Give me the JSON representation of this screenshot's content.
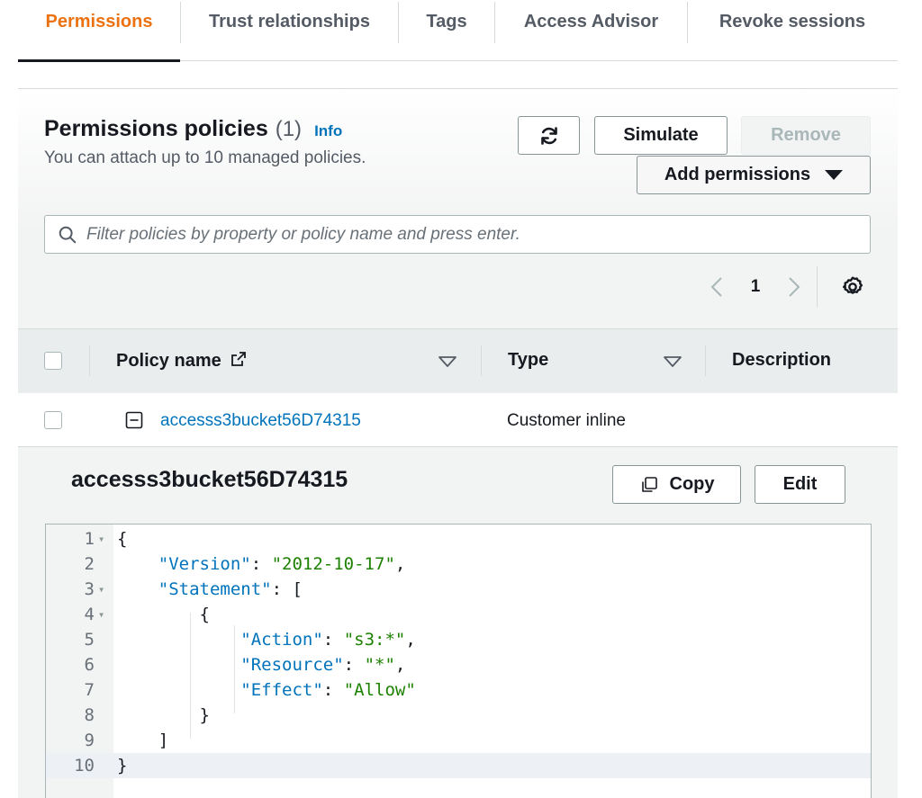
{
  "tabs": [
    {
      "label": "Permissions",
      "active": true
    },
    {
      "label": "Trust relationships",
      "active": false
    },
    {
      "label": "Tags",
      "active": false
    },
    {
      "label": "Access Advisor",
      "active": false
    },
    {
      "label": "Revoke sessions",
      "active": false
    }
  ],
  "panel": {
    "title": "Permissions policies",
    "count": "(1)",
    "info_link": "Info",
    "subtitle": "You can attach up to 10 managed policies."
  },
  "actions": {
    "refresh_icon": "refresh-icon",
    "simulate_label": "Simulate",
    "remove_label": "Remove",
    "add_permissions_label": "Add permissions"
  },
  "search": {
    "placeholder": "Filter policies by property or policy name and press enter.",
    "value": ""
  },
  "pagination": {
    "current_page": "1",
    "settings_icon": "gear-icon"
  },
  "table": {
    "columns": [
      "Policy name",
      "Type",
      "Description"
    ],
    "rows": [
      {
        "policy_name": "accesss3bucket56D74315",
        "type": "Customer inline",
        "description": ""
      }
    ]
  },
  "detail": {
    "title": "accesss3bucket56D74315",
    "copy_label": "Copy",
    "edit_label": "Edit"
  },
  "policy_json_lines": [
    "{",
    "    \"Version\": \"2012-10-17\",",
    "    \"Statement\": [",
    "        {",
    "            \"Action\": \"s3:*\",",
    "            \"Resource\": \"*\",",
    "            \"Effect\": \"Allow\"",
    "        }",
    "    ]",
    "}"
  ],
  "colors": {
    "active_tab": "#ec7211",
    "link": "#0073bb",
    "json_key": "#0073bb",
    "json_string": "#1d8102"
  }
}
